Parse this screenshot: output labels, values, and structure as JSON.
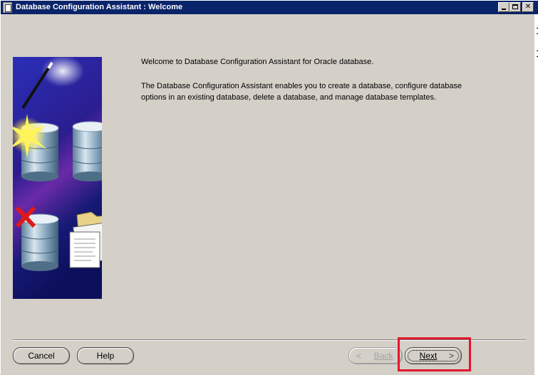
{
  "window": {
    "title": "Database Configuration Assistant : Welcome",
    "controls": {
      "minimize": "_",
      "maximize": "□",
      "close": "✕"
    }
  },
  "content": {
    "welcome": "Welcome to Database Configuration Assistant for Oracle database.",
    "description_lines": [
      "The Database Configuration Assistant enables you to create a database, configure database",
      "options in an existing database, delete a database, and manage database templates."
    ]
  },
  "buttons": {
    "cancel": "Cancel",
    "help": "Help",
    "back": "Back",
    "next": "Next",
    "back_arrow": "<",
    "next_arrow": ">"
  },
  "illustration": {
    "icons": [
      "magic-wand-icon",
      "starburst-icon",
      "database-create-icon",
      "database-configure-icon",
      "checkbox-checked-icon",
      "database-delete-icon",
      "red-x-icon",
      "template-folder-icon"
    ]
  },
  "colors": {
    "titlebar": "#0a246a",
    "window_bg": "#d4d0c8",
    "highlight": "#e3162c",
    "illustration_bg": "#1a1a6e"
  }
}
